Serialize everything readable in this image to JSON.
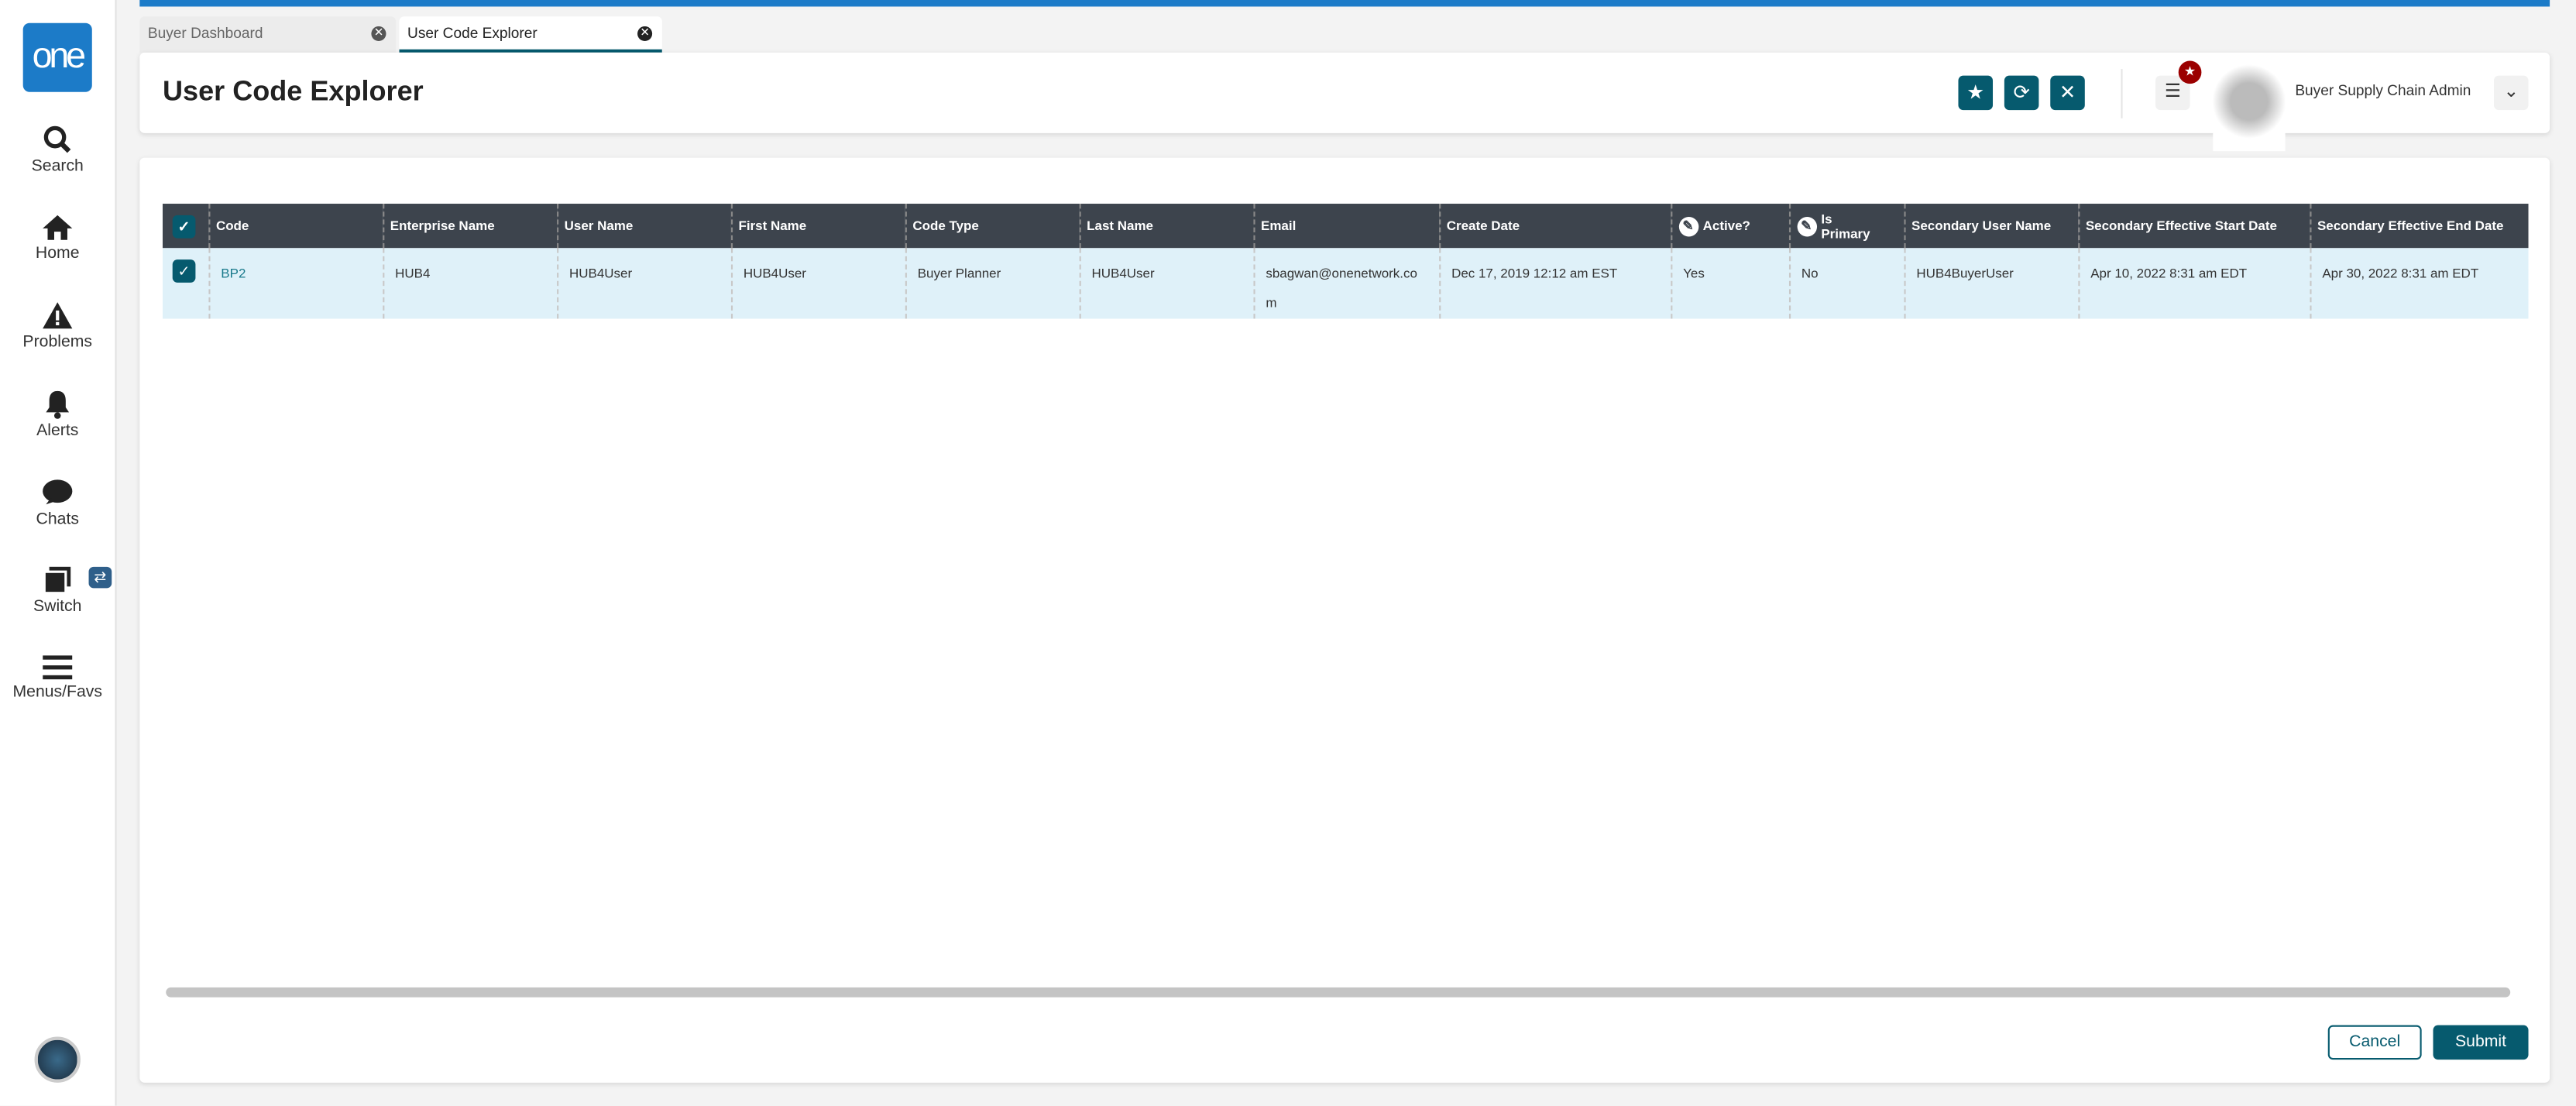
{
  "sidebar": {
    "logo": "one",
    "items": [
      {
        "label": "Search"
      },
      {
        "label": "Home"
      },
      {
        "label": "Problems"
      },
      {
        "label": "Alerts"
      },
      {
        "label": "Chats"
      },
      {
        "label": "Switch"
      },
      {
        "label": "Menus/Favs"
      }
    ]
  },
  "tabs": [
    {
      "label": "Buyer Dashboard"
    },
    {
      "label": "User Code Explorer"
    }
  ],
  "header": {
    "title": "User Code Explorer",
    "role": "Buyer Supply Chain Admin"
  },
  "colors": {
    "brand": "#1c7bc8",
    "accent": "#065a6e",
    "header_bg": "#3d444d",
    "row_selected": "#dff1f9"
  },
  "table": {
    "columns": [
      "Code",
      "Enterprise Name",
      "User Name",
      "First Name",
      "Code Type",
      "Last Name",
      "Email",
      "Create Date",
      "Active?",
      "Is Primary",
      "Secondary User Name",
      "Secondary Effective Start Date",
      "Secondary Effective End Date"
    ],
    "rows": [
      {
        "code": "BP2",
        "enterprise": "HUB4",
        "user": "HUB4User",
        "first": "HUB4User",
        "type": "Buyer Planner",
        "last": "HUB4User",
        "email": "sbagwan@onenetwork.com",
        "created": "Dec 17, 2019 12:12 am EST",
        "active": "Yes",
        "primary": "No",
        "sec_user": "HUB4BuyerUser",
        "sec_start": "Apr 10, 2022 8:31 am EDT",
        "sec_end": "Apr 30, 2022 8:31 am EDT"
      }
    ]
  },
  "footer": {
    "cancel": "Cancel",
    "submit": "Submit"
  }
}
